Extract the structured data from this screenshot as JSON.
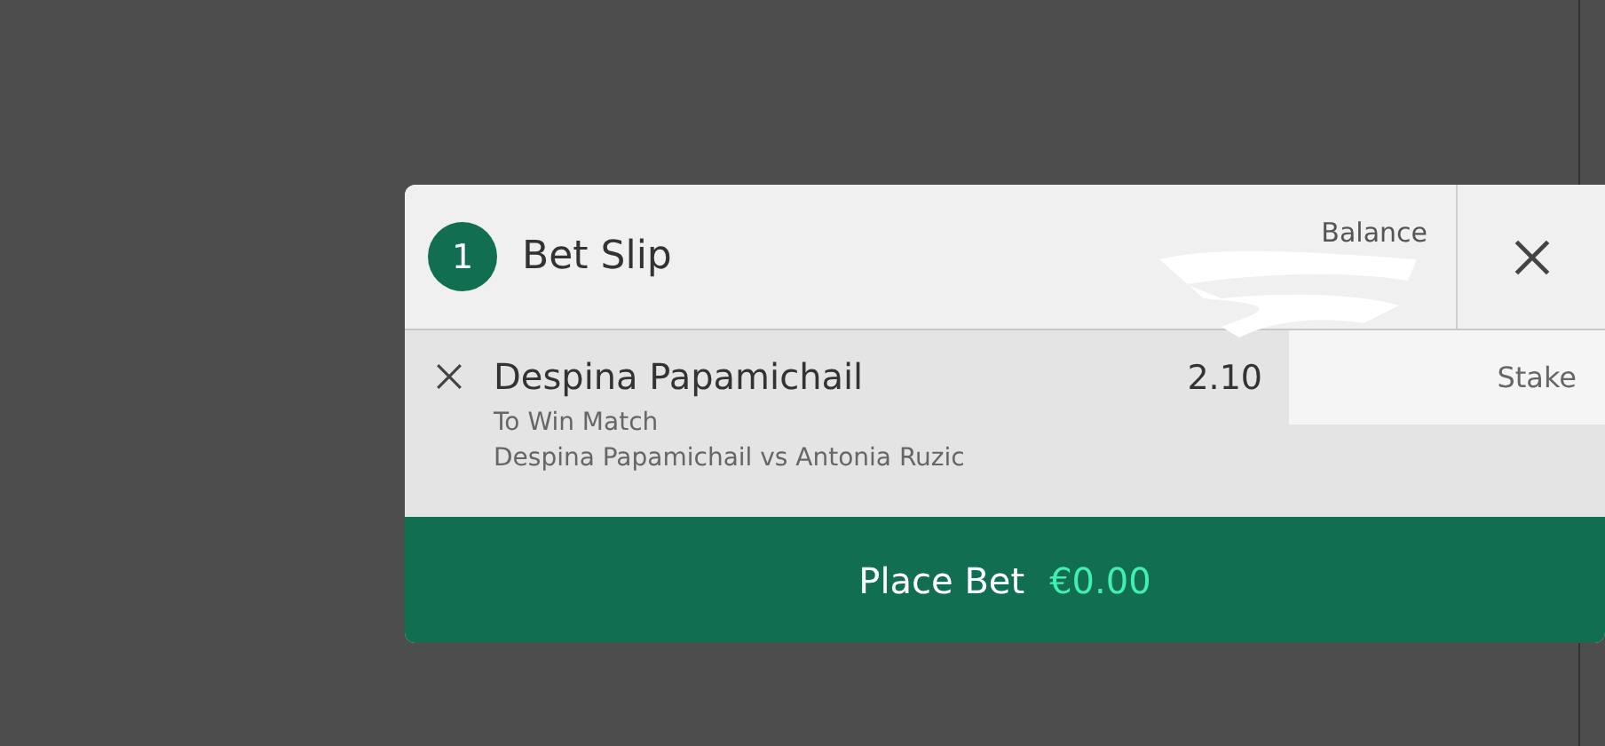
{
  "bet_slip": {
    "count": "1",
    "title": "Bet Slip",
    "balance_label": "Balance",
    "balance_redacted": true,
    "selections": [
      {
        "selection": "Despina Papamichail",
        "market": "To Win Match",
        "event": "Despina Papamichail vs Antonia Ruzic",
        "odds": "2.10",
        "stake_placeholder": "Stake"
      }
    ],
    "place_bet": {
      "label": "Place Bet",
      "amount": "€0.00"
    }
  }
}
